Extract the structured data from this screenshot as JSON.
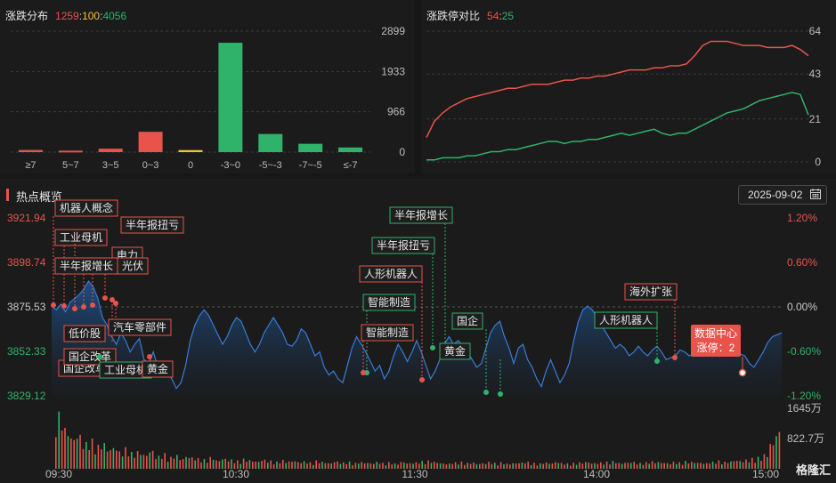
{
  "dist": {
    "title": "涨跌分布",
    "up": "1259",
    "flat": "100",
    "down": "4056",
    "sep": ":",
    "y_ticks": [
      "2899",
      "1933",
      "966",
      "0"
    ],
    "chart_data": {
      "type": "bar",
      "categories": [
        "≥7",
        "5~7",
        "3~5",
        "0~3",
        "0",
        "-3~0",
        "-5~-3",
        "-7~-5",
        "≤-7"
      ],
      "values": [
        50,
        35,
        82,
        487,
        48,
        2620,
        434,
        200,
        110
      ],
      "ylim": [
        0,
        2899
      ],
      "colors": [
        "#e8534b",
        "#e8534b",
        "#e8534b",
        "#e8534b",
        "#f2c230",
        "#2fb36a",
        "#2fb36a",
        "#2fb36a",
        "#2fb36a"
      ]
    }
  },
  "limit": {
    "title": "涨跌停对比",
    "up": "54",
    "down": "25",
    "sep": ":",
    "y_ticks": [
      "64",
      "43",
      "21",
      "0"
    ],
    "chart_data": {
      "type": "line",
      "ylim": [
        0,
        64
      ],
      "series": [
        {
          "values": [
            12,
            20,
            24,
            27,
            29,
            31,
            32,
            33,
            34,
            35,
            36,
            36,
            37,
            38,
            38,
            38,
            39,
            40,
            40,
            41,
            41,
            42,
            42,
            43,
            44,
            45,
            45,
            45,
            46,
            46,
            47,
            47,
            48,
            52,
            57,
            59,
            59,
            59,
            58,
            57,
            57,
            57,
            56,
            56,
            56,
            57,
            55,
            52
          ],
          "color": "#e8534b"
        },
        {
          "values": [
            1,
            1,
            2,
            2,
            2,
            3,
            3,
            4,
            5,
            5,
            6,
            6,
            7,
            8,
            9,
            10,
            10,
            9,
            10,
            10,
            11,
            11,
            12,
            13,
            14,
            13,
            14,
            15,
            16,
            14,
            13,
            14,
            14,
            16,
            18,
            20,
            22,
            24,
            25,
            26,
            28,
            30,
            31,
            32,
            33,
            34,
            33,
            23
          ],
          "color": "#2fb36a"
        }
      ]
    }
  },
  "hot": {
    "title": "热点概览",
    "date": "2025-09-02",
    "y_left": [
      "3921.94",
      "3898.74",
      "3875.53",
      "3852.33",
      "3829.12"
    ],
    "y_right": [
      "1.20%",
      "0.60%",
      "0.00%",
      "-0.60%",
      "-1.20%"
    ],
    "vol_labels": [
      "1645万",
      "822.7万"
    ],
    "x_labels": [
      "09:30",
      "10:30",
      "11:30",
      "14:00",
      "15:00"
    ],
    "tooltip": {
      "title": "数据中心",
      "line": "涨停：2"
    },
    "logo": "格隆汇",
    "tags": [
      {
        "text": "机器人概念",
        "color": "red"
      },
      {
        "text": "工业母机",
        "color": "red"
      },
      {
        "text": "半年报扭亏",
        "color": "red"
      },
      {
        "text": "电力",
        "color": "red"
      },
      {
        "text": "半年报增长",
        "color": "red"
      },
      {
        "text": "光伏",
        "color": "red"
      },
      {
        "text": "低价股",
        "color": "red"
      },
      {
        "text": "汽车零部件",
        "color": "red"
      },
      {
        "text": "国企改革",
        "color": "red"
      },
      {
        "text": "国企改革",
        "color": "red"
      },
      {
        "text": "工业母机",
        "color": "green"
      },
      {
        "text": "黄金",
        "color": "red"
      },
      {
        "text": "半年报增长",
        "color": "green"
      },
      {
        "text": "半年报扭亏",
        "color": "green"
      },
      {
        "text": "人形机器人",
        "color": "red"
      },
      {
        "text": "智能制造",
        "color": "green"
      },
      {
        "text": "智能制造",
        "color": "red"
      },
      {
        "text": "国企",
        "color": "green"
      },
      {
        "text": "黄金",
        "color": "green"
      },
      {
        "text": "人形机器人",
        "color": "green"
      },
      {
        "text": "海外扩张",
        "color": "red"
      }
    ],
    "chart_data": {
      "type": "area",
      "ylim": [
        3829.12,
        3921.94
      ],
      "series": [
        {
          "name": "指数",
          "values": [
            3876,
            3874,
            3877,
            3873,
            3878,
            3880,
            3882,
            3885,
            3889,
            3886,
            3880,
            3870,
            3866,
            3860,
            3856,
            3862,
            3858,
            3852,
            3856,
            3859,
            3848,
            3846,
            3852,
            3844,
            3840,
            3842,
            3838,
            3833,
            3836,
            3845,
            3858,
            3866,
            3871,
            3874,
            3871,
            3866,
            3861,
            3856,
            3860,
            3866,
            3870,
            3868,
            3862,
            3856,
            3852,
            3856,
            3862,
            3866,
            3870,
            3866,
            3862,
            3856,
            3855,
            3858,
            3864,
            3862,
            3856,
            3850,
            3852,
            3844,
            3840,
            3842,
            3838,
            3836,
            3845,
            3854,
            3860,
            3856,
            3852,
            3847,
            3842,
            3845,
            3838,
            3842,
            3850,
            3856,
            3852,
            3847,
            3852,
            3858,
            3852,
            3845,
            3838,
            3842,
            3848,
            3856,
            3860,
            3856,
            3858,
            3855,
            3852,
            3848,
            3844,
            3846,
            3854,
            3862,
            3866,
            3868,
            3860,
            3854,
            3846,
            3854,
            3856,
            3848,
            3844,
            3838,
            3834,
            3842,
            3848,
            3842,
            3836,
            3840,
            3846,
            3858,
            3868,
            3874,
            3876,
            3874,
            3870,
            3866,
            3862,
            3858,
            3854,
            3856,
            3854,
            3850,
            3852,
            3855,
            3852,
            3850,
            3853,
            3855,
            3852,
            3848,
            3849,
            3850,
            3853,
            3852,
            3850,
            3851,
            3853,
            3852,
            3850,
            3851,
            3850,
            3852,
            3855,
            3854,
            3853,
            3851,
            3850,
            3846,
            3844,
            3848,
            3852,
            3857,
            3860,
            3861,
            3862
          ]
        },
        {
          "name": "成交量",
          "values": [
            0.95,
            0.7,
            0.55,
            0.6,
            0.45,
            0.5,
            0.4,
            0.45,
            0.35,
            0.38,
            0.3,
            0.36,
            0.28,
            0.3,
            0.25,
            0.32,
            0.22,
            0.26,
            0.2,
            0.24,
            0.18,
            0.22,
            0.2,
            0.18,
            0.16,
            0.2,
            0.15,
            0.18,
            0.16,
            0.14,
            0.17,
            0.15,
            0.13,
            0.16,
            0.14,
            0.12,
            0.15,
            0.13,
            0.14,
            0.12,
            0.13,
            0.11,
            0.14,
            0.12,
            0.1,
            0.13,
            0.11,
            0.12,
            0.1,
            0.12,
            0.11,
            0.1,
            0.12,
            0.1,
            0.11,
            0.09,
            0.12,
            0.1,
            0.11,
            0.13,
            0.14,
            0.12,
            0.1,
            0.09,
            0.11,
            0.12,
            0.1,
            0.11,
            0.09,
            0.1,
            0.12,
            0.1,
            0.11,
            0.09,
            0.1,
            0.11,
            0.12,
            0.1,
            0.09,
            0.11,
            0.1,
            0.12,
            0.1,
            0.09,
            0.1,
            0.11,
            0.12,
            0.1,
            0.11,
            0.12,
            0.13,
            0.1,
            0.11,
            0.12,
            0.1,
            0.11,
            0.13,
            0.12,
            0.11,
            0.1,
            0.12,
            0.11,
            0.13,
            0.12,
            0.11,
            0.1,
            0.12,
            0.14,
            0.12,
            0.13,
            0.15,
            0.14,
            0.16,
            0.18,
            0.2,
            0.25,
            0.45,
            0.65
          ]
        }
      ]
    }
  }
}
